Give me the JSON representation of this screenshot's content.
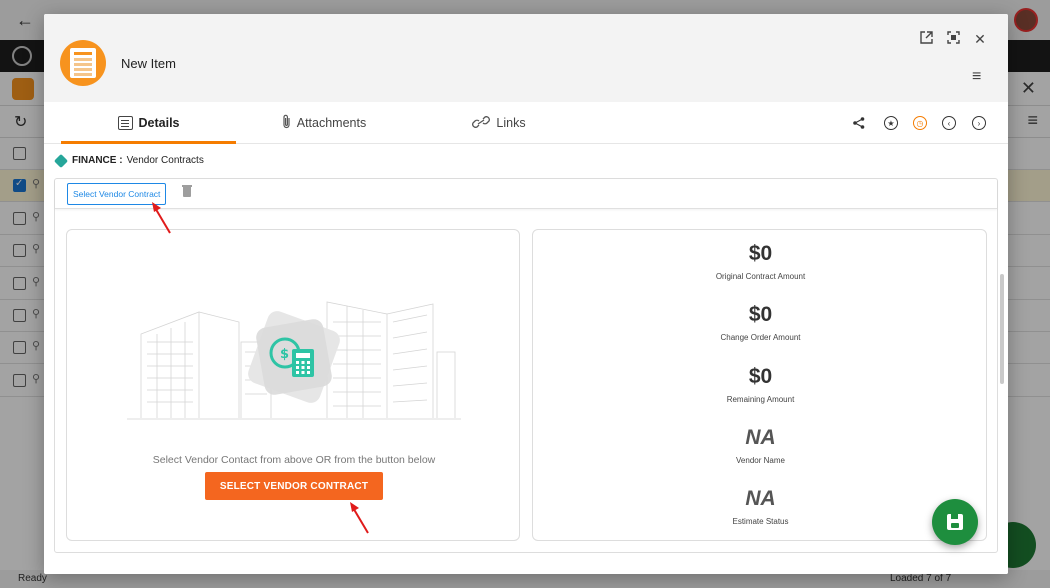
{
  "background": {
    "status_ready": "Ready",
    "status_loaded": "Loaded 7 of 7",
    "list_rows": [
      {
        "selected": false
      },
      {
        "selected": true
      },
      {
        "selected": false
      },
      {
        "selected": false
      },
      {
        "selected": false
      },
      {
        "selected": false
      },
      {
        "selected": false
      },
      {
        "selected": false
      }
    ]
  },
  "modal": {
    "title": "New Item",
    "header_icons": [
      "open-external-icon",
      "fullscreen-icon",
      "close-icon",
      "menu-icon"
    ],
    "tabs": [
      {
        "label": "Details",
        "icon": "details-icon",
        "active": true
      },
      {
        "label": "Attachments",
        "icon": "paperclip-icon",
        "active": false
      },
      {
        "label": "Links",
        "icon": "link-icon",
        "active": false
      }
    ],
    "tab_tools": [
      "share-icon",
      "star-icon",
      "timer-icon",
      "prev-icon",
      "next-icon"
    ],
    "breadcrumb": {
      "module": "FINANCE :",
      "page": "Vendor Contracts"
    },
    "toolbar": {
      "select_label": "Select Vendor Contract"
    },
    "left_card": {
      "message": "Select Vendor Contact from above OR from the button below",
      "button_label": "SELECT VENDOR CONTRACT"
    },
    "stats": [
      {
        "value": "$0",
        "label": "Original Contract Amount"
      },
      {
        "value": "$0",
        "label": "Change Order Amount"
      },
      {
        "value": "$0",
        "label": "Remaining Amount"
      },
      {
        "value": "NA",
        "label": "Vendor Name"
      },
      {
        "value": "NA",
        "label": "Estimate Status"
      }
    ]
  },
  "colors": {
    "accent": "#f57c00",
    "button": "#f4661f",
    "fab": "#1e8e3e",
    "link_blue": "#1e88e5",
    "teal": "#26a69a"
  }
}
